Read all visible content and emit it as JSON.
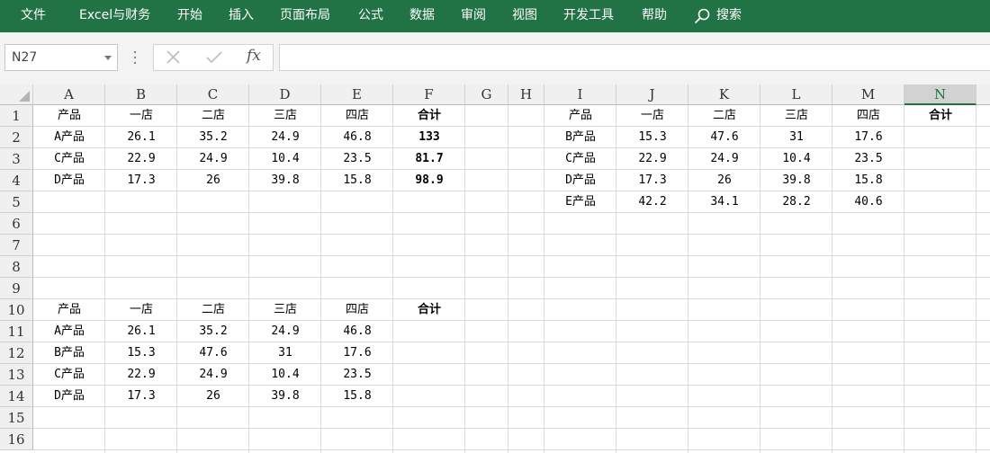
{
  "ribbon": {
    "menu": [
      "文件",
      "Excel与财务",
      "开始",
      "插入",
      "页面布局",
      "公式",
      "数据",
      "审阅",
      "视图",
      "开发工具",
      "帮助"
    ],
    "search_label": "搜索",
    "color": "#217346"
  },
  "formula_bar": {
    "name_box": "N27",
    "formula": "",
    "cancel_icon": "x-icon",
    "enter_icon": "check-icon",
    "fx_label": "fx"
  },
  "columns": [
    "A",
    "B",
    "C",
    "D",
    "E",
    "F",
    "G",
    "H",
    "I",
    "J",
    "K",
    "L",
    "M",
    "N"
  ],
  "selected_column": "N",
  "rows": [
    "1",
    "2",
    "3",
    "4",
    "5",
    "6",
    "7",
    "8",
    "9",
    "10",
    "11",
    "12",
    "13",
    "14",
    "15",
    "16"
  ],
  "table_top_left": {
    "header": [
      "产品",
      "一店",
      "二店",
      "三店",
      "四店",
      "合计"
    ],
    "rows": [
      [
        "A产品",
        "26.1",
        "35.2",
        "24.9",
        "46.8",
        "133"
      ],
      [
        "C产品",
        "22.9",
        "24.9",
        "10.4",
        "23.5",
        "81.7"
      ],
      [
        "D产品",
        "17.3",
        "26",
        "39.8",
        "15.8",
        "98.9"
      ]
    ]
  },
  "table_top_right": {
    "header": [
      "产品",
      "一店",
      "二店",
      "三店",
      "四店",
      "合计"
    ],
    "rows": [
      [
        "B产品",
        "15.3",
        "47.6",
        "31",
        "17.6"
      ],
      [
        "C产品",
        "22.9",
        "24.9",
        "10.4",
        "23.5"
      ],
      [
        "D产品",
        "17.3",
        "26",
        "39.8",
        "15.8"
      ],
      [
        "E产品",
        "42.2",
        "34.1",
        "28.2",
        "40.6"
      ]
    ]
  },
  "table_bottom": {
    "header": [
      "产品",
      "一店",
      "二店",
      "三店",
      "四店",
      "合计"
    ],
    "rows": [
      [
        "A产品",
        "26.1",
        "35.2",
        "24.9",
        "46.8"
      ],
      [
        "B产品",
        "15.3",
        "47.6",
        "31",
        "17.6"
      ],
      [
        "C产品",
        "22.9",
        "24.9",
        "10.4",
        "23.5"
      ],
      [
        "D产品",
        "17.3",
        "26",
        "39.8",
        "15.8"
      ]
    ]
  }
}
